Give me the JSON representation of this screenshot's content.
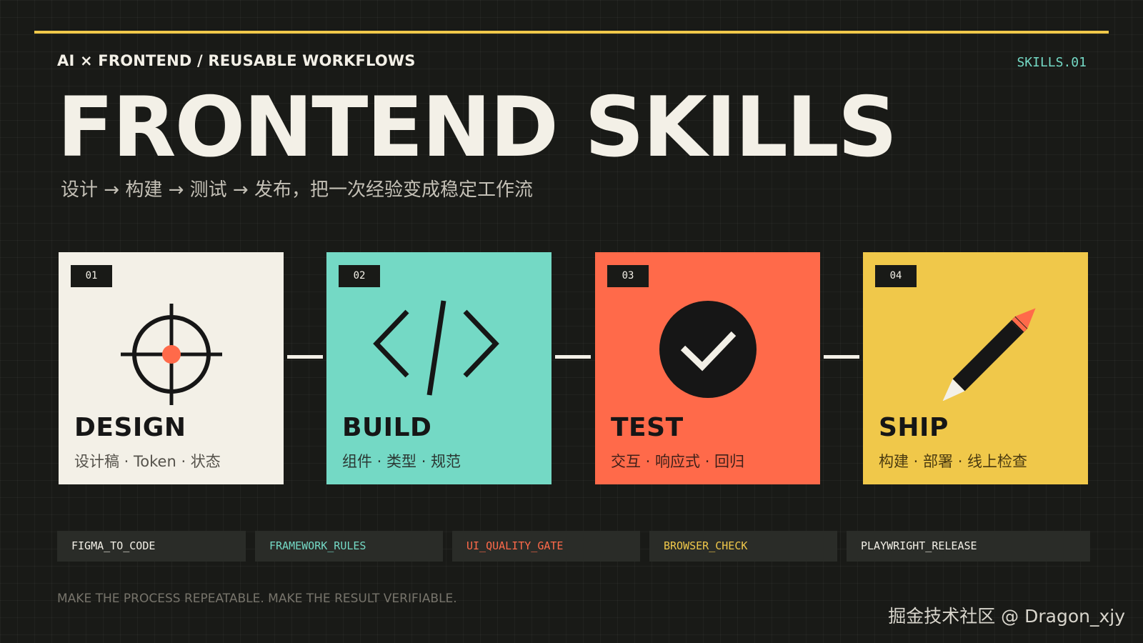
{
  "header": {
    "kicker": "AI × FRONTEND / REUSABLE WORKFLOWS",
    "code_tag": "SKILLS.01",
    "title": "FRONTEND SKILLS",
    "subtitle": "设计 → 构建 → 测试 → 发布，把一次经验变成稳定工作流"
  },
  "cards": [
    {
      "number": "01",
      "name": "DESIGN",
      "desc": "设计稿 · Token · 状态",
      "icon": "crosshair-icon",
      "color": "#f3f0e7"
    },
    {
      "number": "02",
      "name": "BUILD",
      "desc": "组件 · 类型 · 规范",
      "icon": "code-brackets-icon",
      "color": "#74d9c5"
    },
    {
      "number": "03",
      "name": "TEST",
      "desc": "交互 · 响应式 · 回归",
      "icon": "check-circle-icon",
      "color": "#ff6a4a"
    },
    {
      "number": "04",
      "name": "SHIP",
      "desc": "构建 · 部署 · 线上检查",
      "icon": "pencil-icon",
      "color": "#f0c84a"
    }
  ],
  "chips": [
    {
      "label": "FIGMA_TO_CODE",
      "color": "#f3f0e7"
    },
    {
      "label": "FRAMEWORK_RULES",
      "color": "#74d9c5"
    },
    {
      "label": "UI_QUALITY_GATE",
      "color": "#ff6a4a"
    },
    {
      "label": "BROWSER_CHECK",
      "color": "#f0c84a"
    },
    {
      "label": "PLAYWRIGHT_RELEASE",
      "color": "#f3f0e7"
    }
  ],
  "footer": {
    "note": "MAKE THE PROCESS REPEATABLE. MAKE THE RESULT VERIFIABLE.",
    "watermark": "掘金技术社区 @ Dragon_xjy"
  },
  "colors": {
    "background": "#191a17",
    "accent_yellow": "#f0c84a",
    "accent_teal": "#74d9c5",
    "accent_orange": "#ff6a4a",
    "ink": "#161616"
  }
}
